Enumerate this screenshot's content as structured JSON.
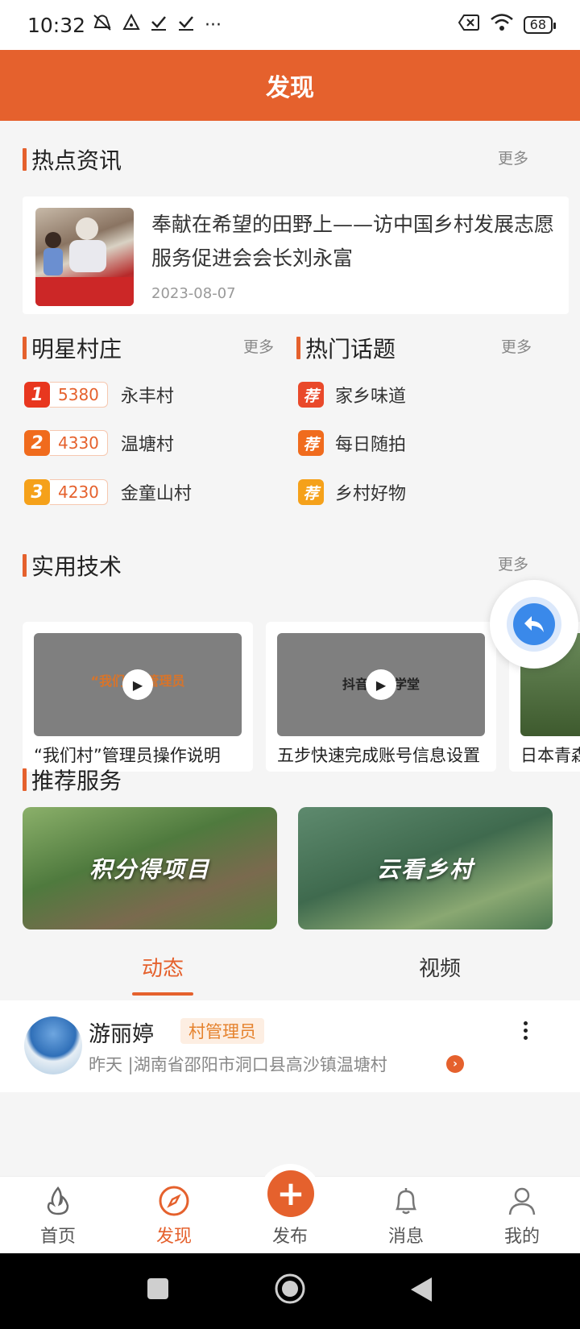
{
  "status_bar": {
    "time": "10:32",
    "icons": [
      "mute-icon",
      "alert-icon",
      "check-icon",
      "check-icon",
      "more-dots"
    ],
    "battery": "68"
  },
  "header": {
    "title": "发现"
  },
  "hot_news": {
    "title": "热点资讯",
    "more": "更多",
    "item": {
      "title": "奉献在希望的田野上——访中国乡村发展志愿服务促进会会长刘永富",
      "date": "2023-08-07"
    }
  },
  "star_villages": {
    "title": "明星村庄",
    "more": "更多",
    "items": [
      {
        "rank": "1",
        "score": "5380",
        "name": "永丰村",
        "color": "#e8371f"
      },
      {
        "rank": "2",
        "score": "4330",
        "name": "温塘村",
        "color": "#f06b1d"
      },
      {
        "rank": "3",
        "score": "4230",
        "name": "金童山村",
        "color": "#f5a11a"
      }
    ]
  },
  "hot_topics": {
    "title": "热门话题",
    "more": "更多",
    "badge": "荐",
    "items": [
      {
        "name": "家乡味道",
        "color": "#e9492a"
      },
      {
        "name": "每日随拍",
        "color": "#f06b1d"
      },
      {
        "name": "乡村好物",
        "color": "#f5a11a"
      }
    ]
  },
  "tech": {
    "title": "实用技术",
    "more": "更多",
    "items": [
      {
        "caption": "“我们村”管理员操作说明",
        "thumb_text": "“我们村”管理员"
      },
      {
        "caption": "五步快速完成账号信息设置",
        "thumb_text": "抖音数字学堂"
      },
      {
        "caption": "日本青森"
      }
    ]
  },
  "services": {
    "title": "推荐服务",
    "items": [
      {
        "label": "积分得项目"
      },
      {
        "label": "云看乡村"
      }
    ]
  },
  "feed_tabs": {
    "items": [
      {
        "label": "动态",
        "active": true
      },
      {
        "label": "视频",
        "active": false
      }
    ]
  },
  "post": {
    "name": "游丽婷",
    "role": "村管理员",
    "meta": "昨天 |湖南省邵阳市洞口县高沙镇温塘村"
  },
  "bottom_nav": {
    "items": [
      {
        "label": "首页"
      },
      {
        "label": "发现",
        "active": true
      },
      {
        "label": "发布"
      },
      {
        "label": "消息"
      },
      {
        "label": "我的"
      }
    ]
  },
  "colors": {
    "brand": "#e5612d",
    "share_blue": "#3a89ea"
  }
}
